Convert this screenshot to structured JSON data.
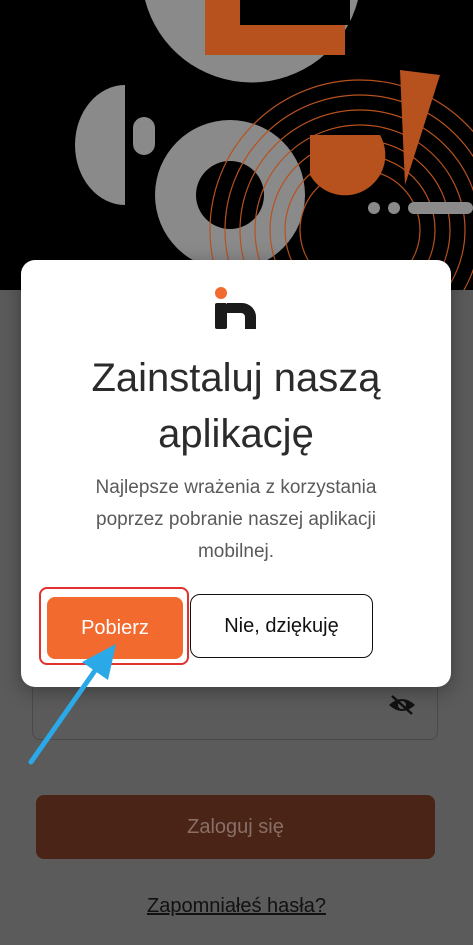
{
  "modal": {
    "title": "Zainstaluj naszą aplikację",
    "description": "Najlepsze wrażenia z korzystania poprzez pobranie naszej aplikacji mobilnej.",
    "download_label": "Pobierz",
    "decline_label": "Nie, dziękuję"
  },
  "login": {
    "submit_label": "Zaloguj się",
    "forgot_label": "Zapomniałeś hasła?"
  },
  "icons": {
    "logo": "app-logo-icon",
    "password_toggle": "eye-off-icon",
    "annotation": "pointer-arrow-icon"
  },
  "colors": {
    "accent": "#f26a2e",
    "highlight": "#e0322e",
    "arrow": "#2aa8e8"
  }
}
